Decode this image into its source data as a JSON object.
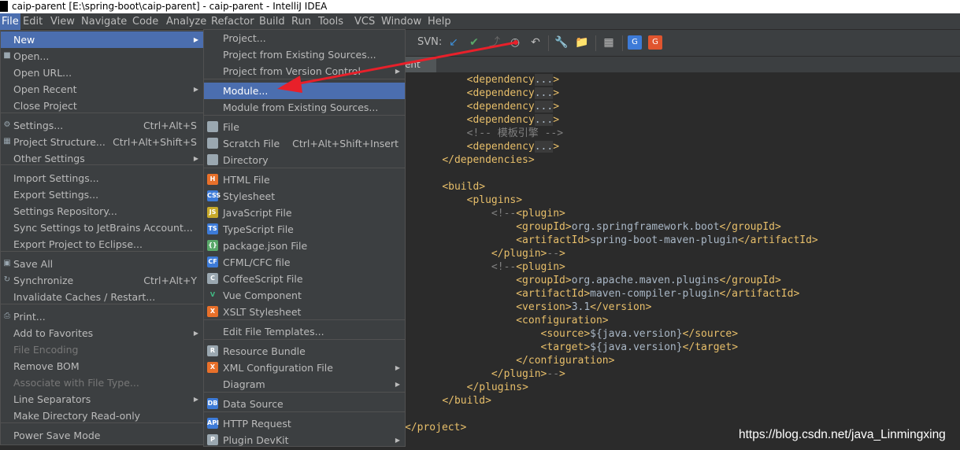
{
  "window": {
    "title": "caip-parent [E:\\spring-boot\\caip-parent] - caip-parent - IntelliJ IDEA"
  },
  "menubar": [
    "File",
    "Edit",
    "View",
    "Navigate",
    "Code",
    "Analyze",
    "Refactor",
    "Build",
    "Run",
    "Tools",
    "VCS",
    "Window",
    "Help"
  ],
  "toolbar": {
    "svn_label": "SVN:"
  },
  "editor_tab": {
    "fragment": "ent"
  },
  "file_menu": [
    {
      "label": "New",
      "submenu": true,
      "highlighted": true
    },
    {
      "label": "Open..."
    },
    {
      "label": "Open URL..."
    },
    {
      "label": "Open Recent",
      "submenu": true
    },
    {
      "label": "Close Project"
    },
    {
      "label": "Settings...",
      "shortcut": "Ctrl+Alt+S"
    },
    {
      "label": "Project Structure...",
      "shortcut": "Ctrl+Alt+Shift+S"
    },
    {
      "label": "Other Settings",
      "submenu": true
    },
    {
      "label": "Import Settings..."
    },
    {
      "label": "Export Settings..."
    },
    {
      "label": "Settings Repository..."
    },
    {
      "label": "Sync Settings to JetBrains Account..."
    },
    {
      "label": "Export Project to Eclipse..."
    },
    {
      "label": "Save All"
    },
    {
      "label": "Synchronize",
      "shortcut": "Ctrl+Alt+Y"
    },
    {
      "label": "Invalidate Caches / Restart..."
    },
    {
      "label": "Print..."
    },
    {
      "label": "Add to Favorites",
      "submenu": true
    },
    {
      "label": "File Encoding",
      "disabled": true
    },
    {
      "label": "Remove BOM"
    },
    {
      "label": "Associate with File Type...",
      "disabled": true
    },
    {
      "label": "Line Separators",
      "submenu": true
    },
    {
      "label": "Make Directory Read-only"
    },
    {
      "label": "Power Save Mode"
    }
  ],
  "new_menu": [
    {
      "label": "Project..."
    },
    {
      "label": "Project from Existing Sources..."
    },
    {
      "label": "Project from Version Control",
      "submenu": true
    },
    {
      "label": "Module...",
      "highlighted": true
    },
    {
      "label": "Module from Existing Sources..."
    },
    {
      "label": "File"
    },
    {
      "label": "Scratch File",
      "shortcut": "Ctrl+Alt+Shift+Insert"
    },
    {
      "label": "Directory"
    },
    {
      "label": "HTML File"
    },
    {
      "label": "Stylesheet"
    },
    {
      "label": "JavaScript File"
    },
    {
      "label": "TypeScript File"
    },
    {
      "label": "package.json File"
    },
    {
      "label": "CFML/CFC file"
    },
    {
      "label": "CoffeeScript File"
    },
    {
      "label": "Vue Component"
    },
    {
      "label": "XSLT Stylesheet"
    },
    {
      "label": "Edit File Templates..."
    },
    {
      "label": "Resource Bundle"
    },
    {
      "label": "XML Configuration File",
      "submenu": true
    },
    {
      "label": "Diagram",
      "submenu": true
    },
    {
      "label": "Data Source"
    },
    {
      "label": "HTTP Request"
    },
    {
      "label": "Plugin DevKit",
      "submenu": true
    }
  ],
  "code_lines": [
    "        <dependency...>",
    "        <dependency...>",
    "        <dependency...>",
    "        <dependency...>",
    "        <!-- 模板引擎 -->",
    "        <dependency...>",
    "    </dependencies>",
    "",
    "    <build>",
    "        <plugins>",
    "            <!--<plugin>",
    "                <groupId>org.springframework.boot</groupId>",
    "                <artifactId>spring-boot-maven-plugin</artifactId>",
    "            </plugin>-->",
    "            <!--<plugin>",
    "                <groupId>org.apache.maven.plugins</groupId>",
    "                <artifactId>maven-compiler-plugin</artifactId>",
    "                <version>3.1</version>",
    "                <configuration>",
    "                    <source>${java.version}</source>",
    "                    <target>${java.version}</target>",
    "                </configuration>",
    "            </plugin>-->",
    "        </plugins>",
    "    </build>",
    "",
    "</project>"
  ],
  "watermark": "https://blog.csdn.net/java_Linmingxing",
  "colors": {
    "highlight": "#4b6eaf",
    "annotation": "#e8202a",
    "xml_tag": "#e8bf6a",
    "comment": "#808080"
  }
}
